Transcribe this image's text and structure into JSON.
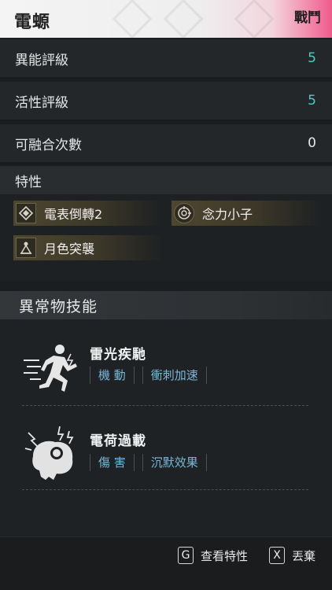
{
  "header": {
    "title": "電螈",
    "tag": "戰鬥"
  },
  "stats": [
    {
      "label": "異能評級",
      "value": "5",
      "color": "#3ed2c0"
    },
    {
      "label": "活性評級",
      "value": "5",
      "color": "#3ed2c0"
    },
    {
      "label": "可融合次數",
      "value": "0",
      "color": "#e8e8e8"
    }
  ],
  "traits": {
    "title": "特性",
    "items": [
      {
        "label": "電表倒轉2",
        "icon": "diamond-icon"
      },
      {
        "label": "念力小子",
        "icon": "psychic-target-icon"
      },
      {
        "label": "月色突襲",
        "icon": "moon-raid-icon"
      }
    ]
  },
  "abilities": {
    "title": "異常物技能",
    "skills": [
      {
        "name": "雷光疾馳",
        "tags": [
          "機 動",
          "衝刺加速"
        ],
        "icon": "sprinting-figure-icon"
      },
      {
        "name": "電荷過載",
        "tags": [
          "傷 害",
          "沉默效果"
        ],
        "icon": "charged-creature-icon"
      }
    ]
  },
  "footer": {
    "view_key": "G",
    "view_label": "查看特性",
    "drop_key": "X",
    "drop_label": "丟棄"
  }
}
